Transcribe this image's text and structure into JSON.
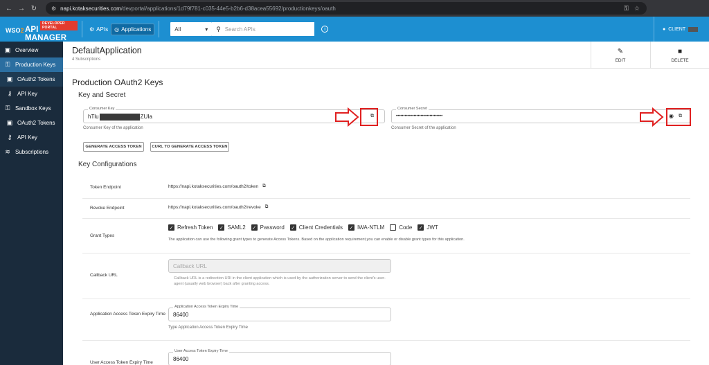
{
  "browser": {
    "url_host": "napi.kotaksecurities.com",
    "url_path": "/devportal/applications/1d79f781-c035-44e5-b2b6-d38acea55692/productionkeys/oauth"
  },
  "header": {
    "portal_badge": "DEVELOPER PORTAL",
    "brand_wso": "WSO",
    "brand_two": "2",
    "brand_name": "API MANAGER",
    "apis_label": "APIs",
    "applications_label": "Applications",
    "filter_selected": "All",
    "search_placeholder": "Search APIs",
    "user_label": "CLIENT"
  },
  "sidebar": {
    "items": [
      {
        "label": "Overview"
      },
      {
        "label": "Production Keys"
      },
      {
        "label": "OAuth2 Tokens"
      },
      {
        "label": "API Key"
      },
      {
        "label": "Sandbox Keys"
      },
      {
        "label": "OAuth2 Tokens"
      },
      {
        "label": "API Key"
      },
      {
        "label": "Subscriptions"
      }
    ]
  },
  "app": {
    "name": "DefaultApplication",
    "subscriptions": "4 Subscriptions",
    "edit_label": "EDIT",
    "delete_label": "DELETE"
  },
  "keys": {
    "section_title": "Production OAuth2 Keys",
    "subtitle": "Key and Secret",
    "consumer_key_legend": "Consumer Key",
    "consumer_key_prefix": "hTlu",
    "consumer_key_suffix": "ZUIa",
    "consumer_key_help": "Consumer Key of the application",
    "consumer_secret_legend": "Consumer Secret",
    "consumer_secret_value": "••••••••••••••••••••••••••••••••",
    "consumer_secret_help": "Consumer Secret of the application",
    "generate_btn": "GENERATE ACCESS TOKEN",
    "curl_btn": "CURL TO GENERATE ACCESS TOKEN"
  },
  "config": {
    "title": "Key Configurations",
    "token_endpoint_label": "Token Endpoint",
    "token_endpoint_value": "https://napi.kotaksecurities.com/oauth2/token",
    "revoke_endpoint_label": "Revoke Endpoint",
    "revoke_endpoint_value": "https://napi.kotaksecurities.com/oauth2/revoke",
    "grant_types_label": "Grant Types",
    "grants": [
      {
        "label": "Refresh Token",
        "checked": true
      },
      {
        "label": "SAML2",
        "checked": true
      },
      {
        "label": "Password",
        "checked": true
      },
      {
        "label": "Client Credentials",
        "checked": true
      },
      {
        "label": "IWA-NTLM",
        "checked": true
      },
      {
        "label": "Code",
        "checked": false
      },
      {
        "label": "JWT",
        "checked": true
      }
    ],
    "grant_help": "The application can use the following grant types to generate Access Tokens. Based on the application requirement,you can enable or disable grant types for this application.",
    "callback_label": "Callback URL",
    "callback_placeholder": "Callback URL",
    "callback_help": "Callback URL is a redirection URI in the client application which is used by the authorization server to send the client's user-agent (usually web browser) back after granting access.",
    "app_token_expiry_label": "Application Access Token Expiry Time",
    "app_token_expiry_legend": "Application Access Token Expiry Time",
    "app_token_expiry_value": "86400",
    "app_token_expiry_help": "Type Application Access Token Expiry Time",
    "user_token_expiry_label": "User Access Token Expiry Time",
    "user_token_expiry_legend": "User Access Token Expiry Time",
    "user_token_expiry_value": "86400"
  },
  "colors": {
    "header_blue": "#1d8fd1",
    "sidebar_bg": "#1a2b3c",
    "sidebar_active": "#2b6ea0",
    "annotation_red": "#e02020"
  }
}
